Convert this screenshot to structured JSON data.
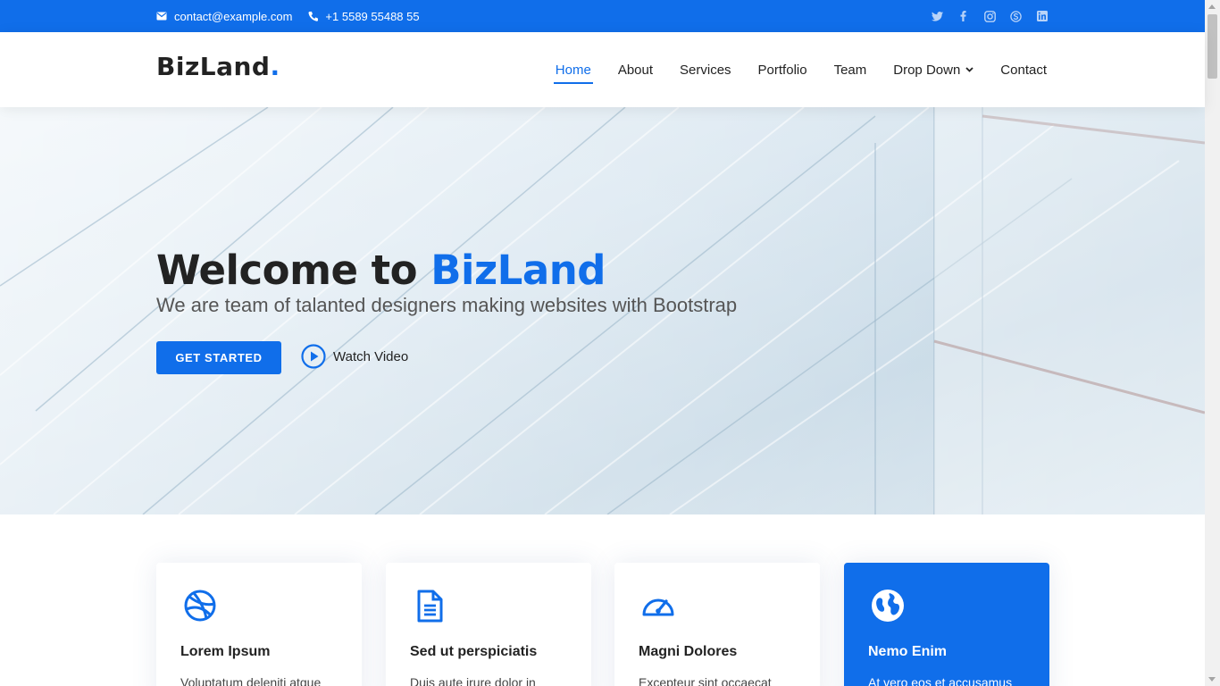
{
  "topbar": {
    "email": "contact@example.com",
    "phone": "+1 5589 55488 55",
    "social": [
      "twitter-icon",
      "facebook-icon",
      "instagram-icon",
      "skype-icon",
      "linkedin-icon"
    ]
  },
  "header": {
    "logo": "BizLand",
    "logo_dot": ".",
    "nav": [
      {
        "label": "Home",
        "active": true
      },
      {
        "label": "About"
      },
      {
        "label": "Services"
      },
      {
        "label": "Portfolio"
      },
      {
        "label": "Team"
      },
      {
        "label": "Drop Down",
        "dropdown": true
      },
      {
        "label": "Contact"
      }
    ]
  },
  "hero": {
    "title_prefix": "Welcome to ",
    "title_brand": "BizLand",
    "subtitle": "We are team of talanted designers making websites with Bootstrap",
    "cta": "GET STARTED",
    "watch_video": "Watch Video"
  },
  "services": [
    {
      "icon": "dribbble-icon",
      "title": "Lorem Ipsum",
      "text": "Voluptatum deleniti atque"
    },
    {
      "icon": "document-icon",
      "title": "Sed ut perspiciatis",
      "text": "Duis aute irure dolor in"
    },
    {
      "icon": "speedometer-icon",
      "title": "Magni Dolores",
      "text": "Excepteur sint occaecat"
    },
    {
      "icon": "globe-icon",
      "title": "Nemo Enim",
      "text": "At vero eos et accusamus",
      "featured": true
    }
  ],
  "colors": {
    "accent": "#106eea",
    "text": "#222222"
  }
}
